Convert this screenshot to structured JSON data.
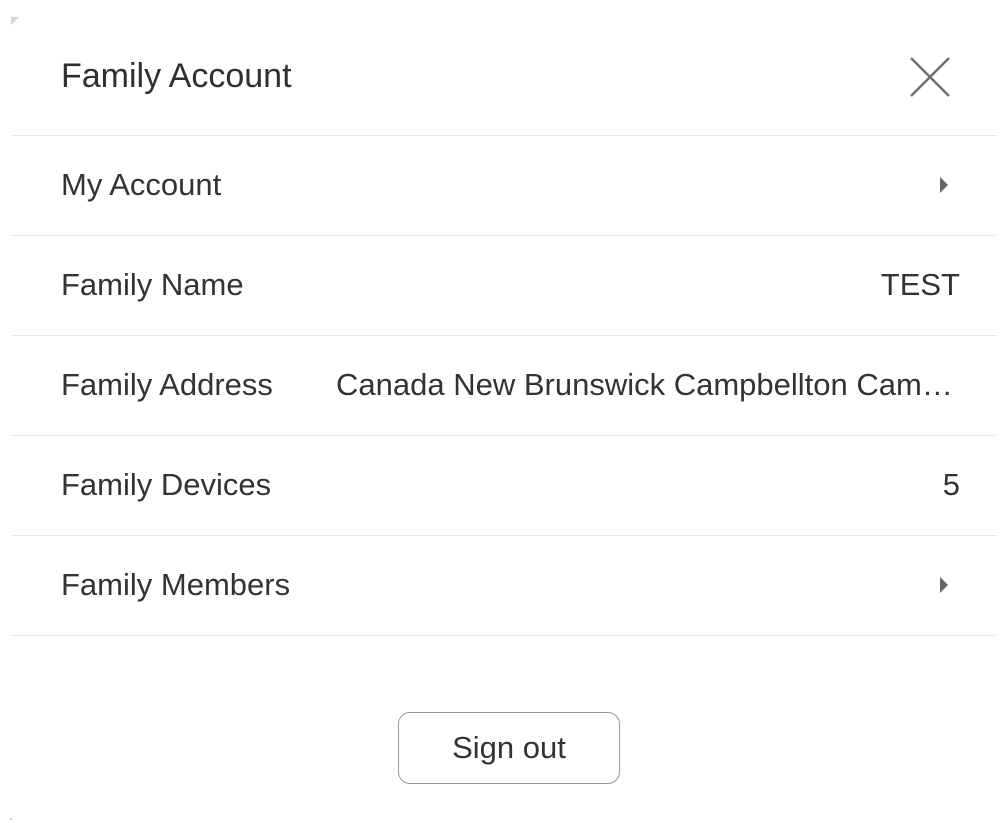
{
  "header": {
    "title": "Family Account",
    "close_icon": "close-icon"
  },
  "rows": [
    {
      "label": "My Account",
      "value": "",
      "icon": "chevron-right-icon"
    },
    {
      "label": "Family Name",
      "value": "TEST"
    },
    {
      "label": "Family Address",
      "value": "Canada New Brunswick Campbellton Campbellton"
    },
    {
      "label": "Family Devices",
      "value": "5"
    },
    {
      "label": "Family Members",
      "value": "",
      "icon": "chevron-right-icon"
    }
  ],
  "footer": {
    "sign_out_label": "Sign out"
  },
  "colors": {
    "text": "#333333",
    "divider": "#e6e6e6",
    "button_border": "#9a9a9a",
    "icon": "#666666"
  }
}
